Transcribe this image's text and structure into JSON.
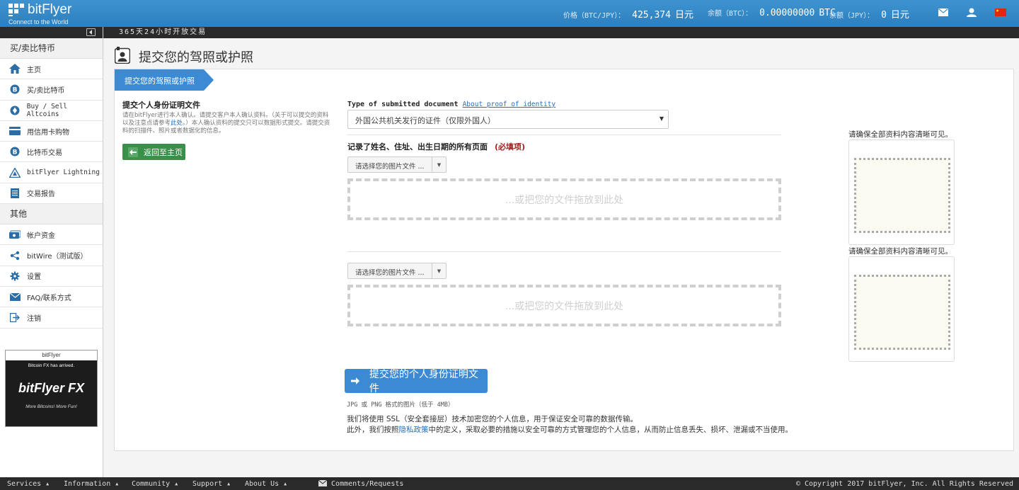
{
  "header": {
    "brand": "bitFlyer",
    "tagline": "Connect to the World",
    "price_label": "价格（BTC/JPY）：",
    "price_value": "425,374",
    "price_unit": "日元",
    "btc_balance_label": "余额（BTC）：",
    "btc_balance_value": "0.00000000",
    "btc_balance_unit": "BTC",
    "jpy_balance_label": "余额（JPY）：",
    "jpy_balance_value": "0",
    "jpy_balance_unit": "日元"
  },
  "ticker": "365天24小时开放交易",
  "sidebar": {
    "section1": "买/卖比特币",
    "items1": [
      {
        "label": "主页",
        "icon": "home-icon"
      },
      {
        "label": "买/卖比特币",
        "icon": "bitcoin-icon"
      },
      {
        "label": "Buy / Sell Altcoins",
        "icon": "altcoin-icon"
      },
      {
        "label": "用信用卡购物",
        "icon": "credit-card-icon"
      },
      {
        "label": "比特币交易",
        "icon": "bitcoin-trade-icon"
      },
      {
        "label": "bitFlyer Lightning",
        "icon": "lightning-icon"
      },
      {
        "label": "交易报告",
        "icon": "report-icon"
      }
    ],
    "section2": "其他",
    "items2": [
      {
        "label": "帐户资金",
        "icon": "account-funds-icon"
      },
      {
        "label": "bitWire（测试版）",
        "icon": "share-icon"
      },
      {
        "label": "设置",
        "icon": "gear-icon"
      },
      {
        "label": "FAQ/联系方式",
        "icon": "mail-icon"
      },
      {
        "label": "注销",
        "icon": "logout-icon"
      }
    ],
    "ad": {
      "brand": "bitFlyer",
      "subtitle": "Bitcoin FX has arrived.",
      "title": "bitFlyer FX",
      "footer": "More Bitcoins! More Fun!"
    }
  },
  "main": {
    "page_title": "提交您的驾照或护照",
    "breadcrumb": "提交您的驾照或护照",
    "left_title": "提交个人身份证明文件",
    "left_desc_1": "请在bitFlyer进行本人确认。请提交客户本人确认资料。（关于可以提交的资料以及注意点请参考",
    "left_desc_link": "此处",
    "left_desc_2": "。）本人确认资料的提交只可以数据形式提交。请提交资料的扫描件、照片或者数据化的信息。",
    "back_button": "返回至主页",
    "doc_type_label": "Type of submitted document",
    "doc_type_link": "About proof of identity",
    "doc_type_value": "外国公共机关发行的证件（仅限外国人）",
    "section_title": "记录了姓名、住址、出生日期的所有页面",
    "required": "(必填项)",
    "file_button_1": "请选择您的图片文件 ...",
    "drop_text_1": "...或把您的文件拖放到此处",
    "file_button_2": "请选择您的图片文件 ...",
    "drop_text_2": "...或把您的文件拖放到此处",
    "submit_button": "提交您的个人身份证明文件",
    "format_note": "JPG 或 PNG 格式的图片（低于 4MB）",
    "ssl_note_1": "我们将使用 SSL（安全套接层）技术加密您的个人信息，用于保证安全可靠的数据传输。",
    "ssl_note_2a": "此外，我们按照",
    "ssl_note_link": "隐私政策",
    "ssl_note_2b": "中的定义，采取必要的措施以安全可靠的方式管理您的个人信息，从而防止信息丢失、损坏、泄漏或不当使用。",
    "preview_note_1": "请确保全部资料内容清晰可见。",
    "preview_note_2": "请确保全部资料内容清晰可见。"
  },
  "footer": {
    "services": "Services ▴",
    "information": "Information ▴",
    "community": "Community ▴",
    "support": "Support ▴",
    "about": "About Us ▴",
    "comments": "Comments/Requests",
    "copyright": "© Copyright 2017 bitFlyer, Inc. All Rights Reserved"
  },
  "colors": {
    "header_blue": "#3d93cf",
    "breadcrumb_blue": "#3b8ad3",
    "back_green": "#3a8f4a",
    "required_red": "#a02020",
    "dark_bar": "#2a2a2a"
  }
}
